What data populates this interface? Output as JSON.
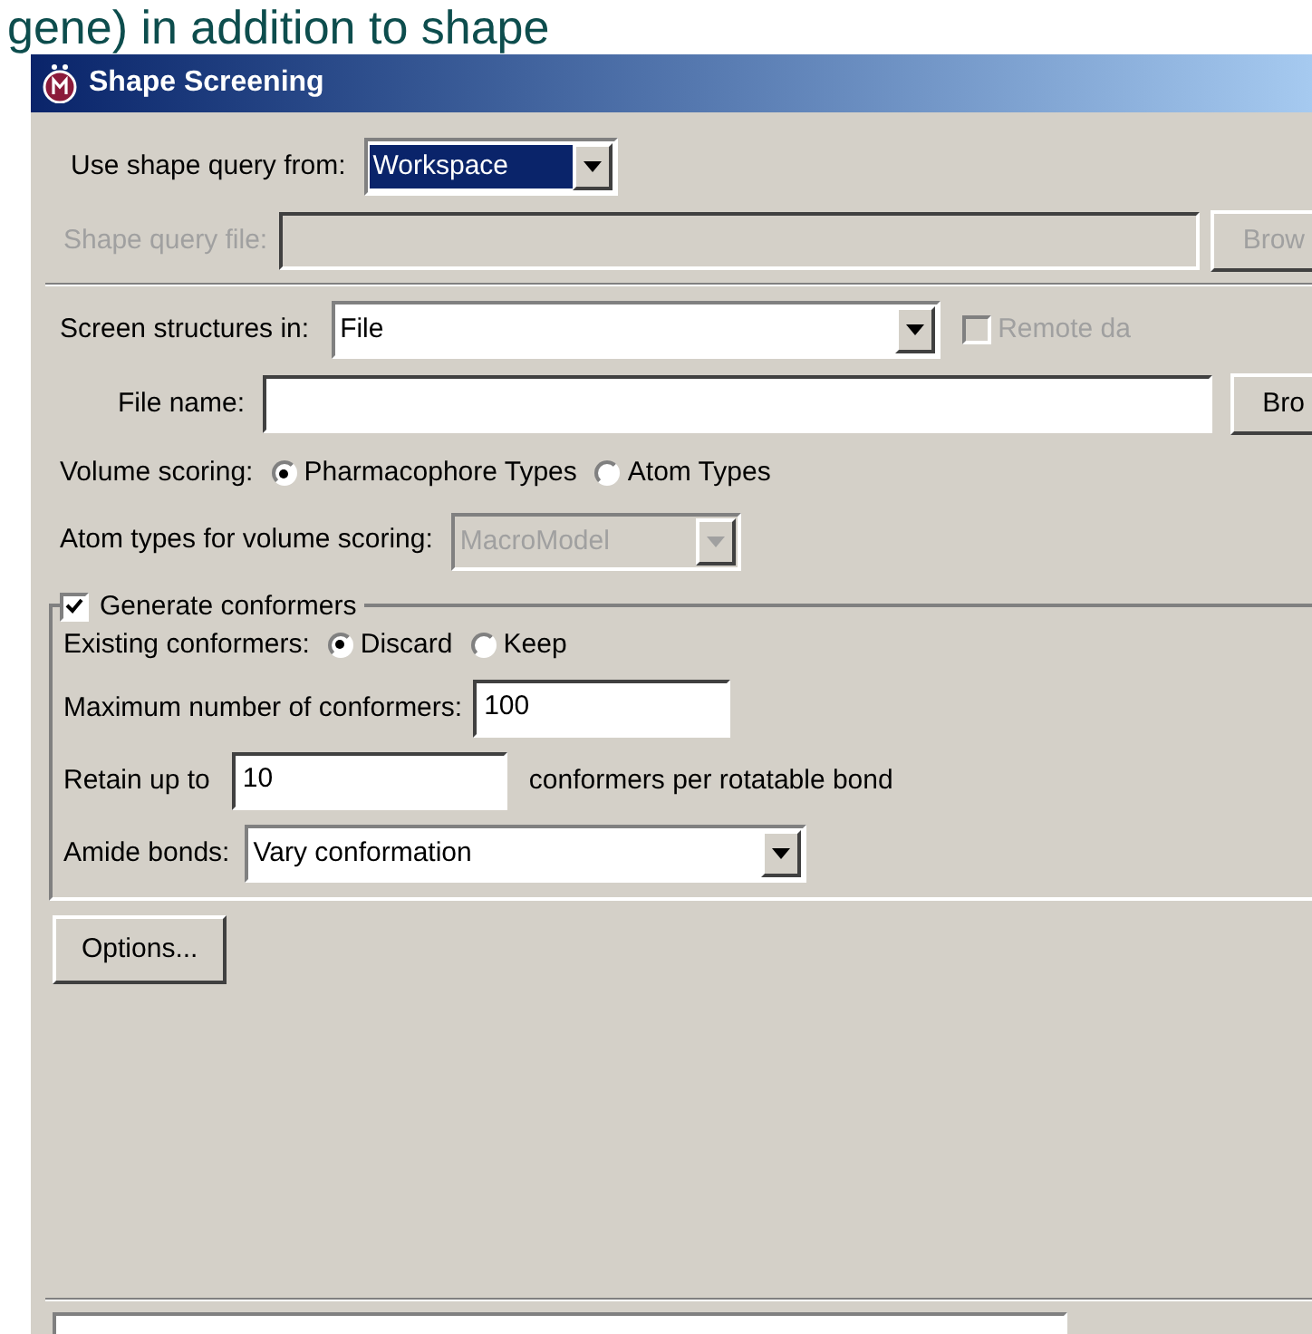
{
  "slide_caption": "gene) in addition to shape",
  "window": {
    "title": "Shape Screening"
  },
  "query_source": {
    "label": "Use shape query from:",
    "value": "Workspace",
    "focused": true
  },
  "query_file": {
    "label": "Shape query file:",
    "disabled": true,
    "button": "Brow"
  },
  "screen_in": {
    "label": "Screen structures in:",
    "value": "File"
  },
  "remote": {
    "label": "Remote da",
    "checked": false,
    "disabled": true
  },
  "file_name": {
    "label": "File name:",
    "button": "Bro"
  },
  "volume_scoring": {
    "label": "Volume scoring:",
    "options": [
      {
        "label": "Pharmacophore Types",
        "selected": true
      },
      {
        "label": "Atom Types",
        "selected": false
      }
    ]
  },
  "atom_types": {
    "label": "Atom types for volume scoring:",
    "value": "MacroModel",
    "disabled": true
  },
  "conformers": {
    "label": "Generate conformers",
    "checked": true,
    "existing": {
      "label": "Existing conformers:",
      "options": [
        {
          "label": "Discard",
          "selected": true
        },
        {
          "label": "Keep",
          "selected": false
        }
      ]
    },
    "max": {
      "label": "Maximum number of conformers:",
      "value": "100"
    },
    "retain": {
      "label": "Retain up to",
      "value": "10",
      "suffix": "conformers per rotatable bond"
    },
    "amide": {
      "label": "Amide bonds:",
      "value": "Vary conformation"
    }
  },
  "options_button": "Options..."
}
